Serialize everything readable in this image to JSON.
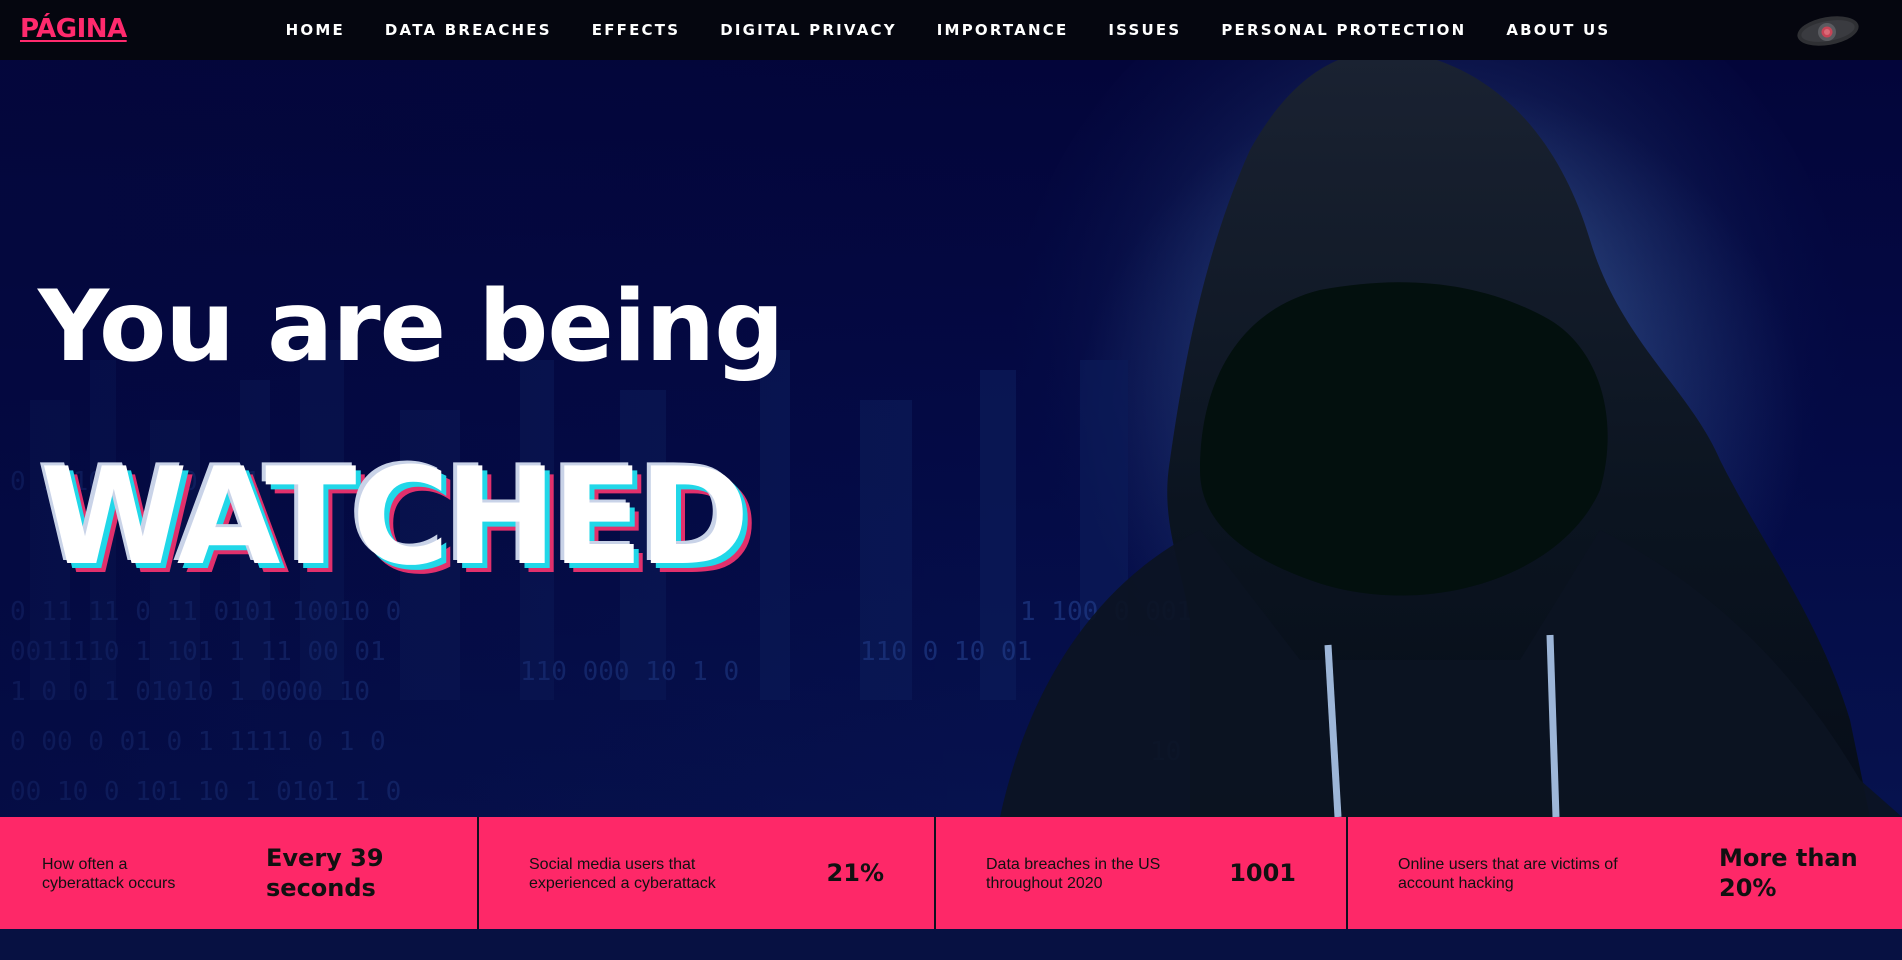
{
  "nav": {
    "brand": "PÁGINA",
    "links": [
      "HOME",
      "DATA BREACHES",
      "EFFECTS",
      "DIGITAL PRIVACY",
      "IMPORTANCE",
      "ISSUES",
      "PERSONAL PROTECTION",
      "ABOUT US"
    ],
    "eye_icon": "eye-icon"
  },
  "hero": {
    "line1": "You are being",
    "line2": "WATCHED"
  },
  "stats": [
    {
      "label": "How often a cyberattack occurs",
      "value": "Every 39 seconds"
    },
    {
      "label": "Social media users that experienced a cyberattack",
      "value": "21%"
    },
    {
      "label": "Data breaches in the US throughout 2020",
      "value": "1001"
    },
    {
      "label": "Online users that are victims of account hacking",
      "value": "More than 20%"
    }
  ],
  "colors": {
    "accent": "#fe2868",
    "brand": "#ff2a6d",
    "nav_bg": "#05060f",
    "hero_bg": "#03053a",
    "glitch_cyan": "#21d7e8",
    "glitch_pink": "#e2306c"
  }
}
